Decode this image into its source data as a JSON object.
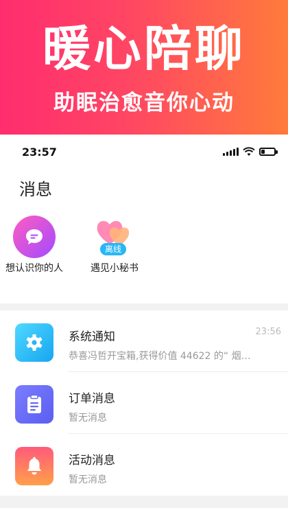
{
  "promo": {
    "title": "暖心陪聊",
    "subtitle": "助眠治愈音你心动"
  },
  "status_bar": {
    "time": "23:57",
    "battery_level": 0.3
  },
  "page": {
    "title": "消息"
  },
  "quick_entries": [
    {
      "label": "想认识你的人",
      "icon": "chat-bubble-icon"
    },
    {
      "label": "遇见小秘书",
      "icon": "hearts-icon",
      "badge": "离线"
    }
  ],
  "messages": [
    {
      "title": "系统通知",
      "preview": "恭喜冯哲开宝箱,获得价值 44622 的“ 烟…",
      "time": "23:56",
      "icon": "gear-icon",
      "color": "#17a6f0"
    },
    {
      "title": "订单消息",
      "preview": "暂无消息",
      "time": "",
      "icon": "clipboard-icon",
      "color": "#5b5ef0"
    },
    {
      "title": "活动消息",
      "preview": "暂无消息",
      "time": "",
      "icon": "bell-icon",
      "color": "#ff7a5c"
    }
  ]
}
